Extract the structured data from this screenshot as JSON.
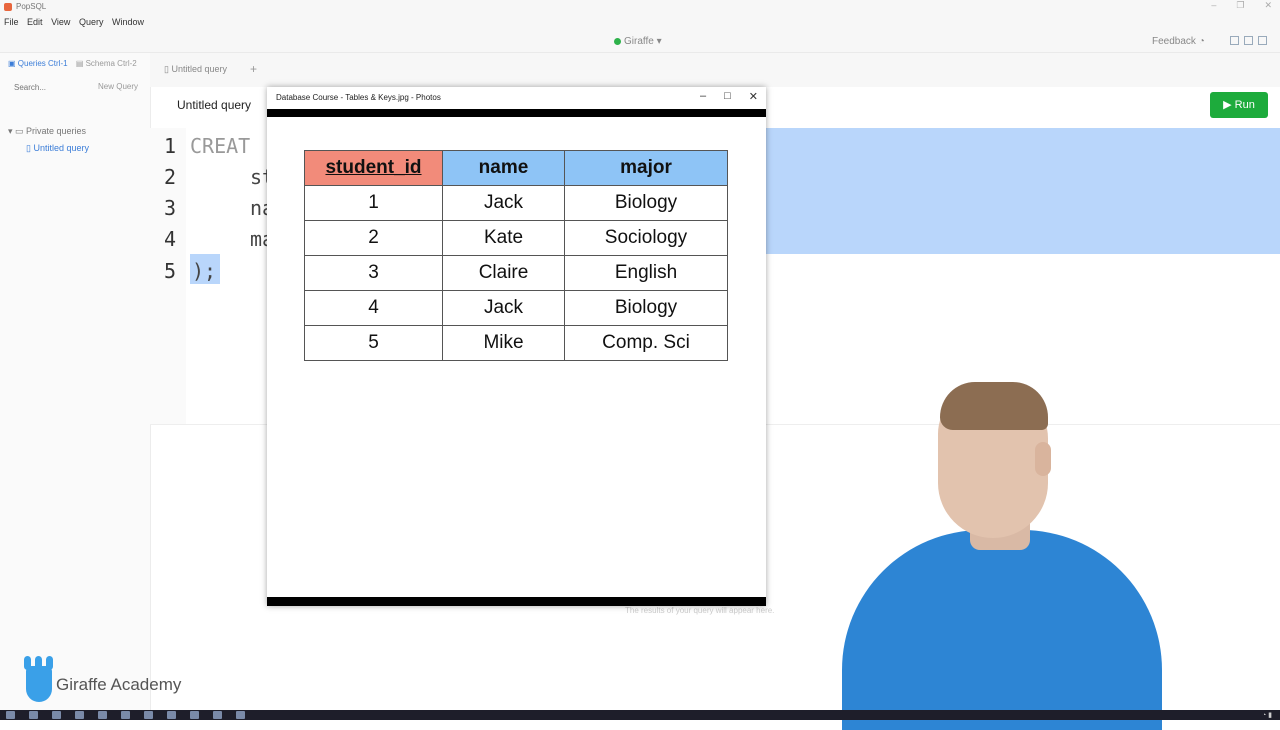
{
  "app": {
    "title": "PopSQL",
    "menu": [
      "File",
      "Edit",
      "View",
      "Query",
      "Window"
    ],
    "connection": "Giraffe",
    "feedback": "Feedback"
  },
  "sidebar": {
    "tab_queries": "Queries Ctrl-1",
    "tab_schema": "Schema Ctrl-2",
    "search_placeholder": "Search...",
    "new_query": "New Query",
    "folder": "Private queries",
    "query_item": "Untitled query"
  },
  "editor_tab": {
    "label": "Untitled query"
  },
  "query": {
    "title": "Untitled query",
    "run_label": "Run",
    "line_numbers": [
      "1",
      "2",
      "3",
      "4",
      "5"
    ],
    "lines": [
      "CREAT",
      "st",
      "na",
      "ma",
      ");"
    ],
    "results_hint": "The results of your query will appear here."
  },
  "photos": {
    "window_title": "Database Course - Tables & Keys.jpg - Photos",
    "table": {
      "headers": [
        "student_id",
        "name",
        "major"
      ],
      "rows": [
        [
          "1",
          "Jack",
          "Biology"
        ],
        [
          "2",
          "Kate",
          "Sociology"
        ],
        [
          "3",
          "Claire",
          "English"
        ],
        [
          "4",
          "Jack",
          "Biology"
        ],
        [
          "5",
          "Mike",
          "Comp. Sci"
        ]
      ]
    },
    "colors": {
      "primary_key_header": "#f28b7a",
      "header": "#8ec4f6"
    }
  },
  "brand": {
    "name": "Giraffe Academy"
  },
  "colors": {
    "run_button": "#1dab3c",
    "accent": "#3b7dd8",
    "selection": "#b9d6fb"
  }
}
